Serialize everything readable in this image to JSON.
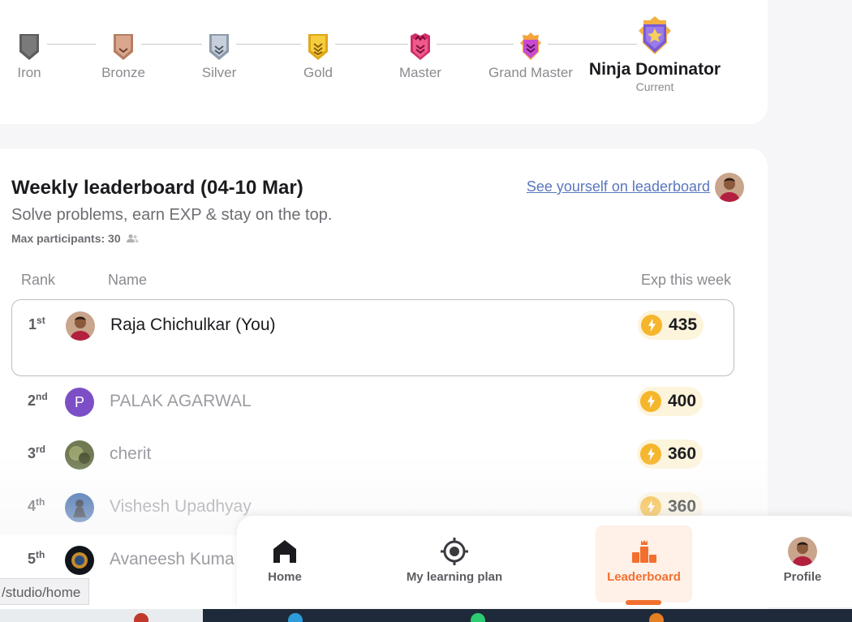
{
  "ranks": {
    "items": [
      {
        "label": "Iron",
        "color": "#6b6b6b"
      },
      {
        "label": "Bronze",
        "color": "#c9957a"
      },
      {
        "label": "Silver",
        "color": "#a9b4c2"
      },
      {
        "label": "Gold",
        "color": "#f2c12e"
      },
      {
        "label": "Master",
        "color": "#e64177"
      },
      {
        "label": "Grand Master",
        "color": "#d65fd8"
      }
    ],
    "current": {
      "label": "Ninja Dominator",
      "sub": "Current",
      "color": "#8a6ae0"
    }
  },
  "leaderboard": {
    "title": "Weekly leaderboard (04-10 Mar)",
    "subtitle": "Solve problems, earn EXP & stay on the top.",
    "max_participants": "Max participants: 30",
    "see_yourself": "See yourself on leaderboard",
    "columns": {
      "rank": "Rank",
      "name": "Name",
      "exp": "Exp this week"
    },
    "rows": [
      {
        "rank": "1",
        "suffix": "st",
        "name": "Raja Chichulkar (You)",
        "exp": "435",
        "avatar": "photo"
      },
      {
        "rank": "2",
        "suffix": "nd",
        "name": "PALAK AGARWAL",
        "exp": "400",
        "avatar": "letter",
        "initial": "P"
      },
      {
        "rank": "3",
        "suffix": "rd",
        "name": "cherit",
        "exp": "360",
        "avatar": "photo"
      },
      {
        "rank": "4",
        "suffix": "th",
        "name": "Vishesh Upadhyay",
        "exp": "360",
        "avatar": "photo"
      },
      {
        "rank": "5",
        "suffix": "th",
        "name": "Avaneesh Kuma",
        "exp": "",
        "avatar": "photo"
      }
    ]
  },
  "nav": {
    "home": "Home",
    "learning_plan": "My learning plan",
    "leaderboard": "Leaderboard",
    "profile": "Profile"
  },
  "status_url": "/studio/home",
  "colors": {
    "accent": "#f2702f",
    "exp_bg": "#fdf4dc",
    "bolt": "#f6b62c",
    "link": "#5a76bf"
  }
}
